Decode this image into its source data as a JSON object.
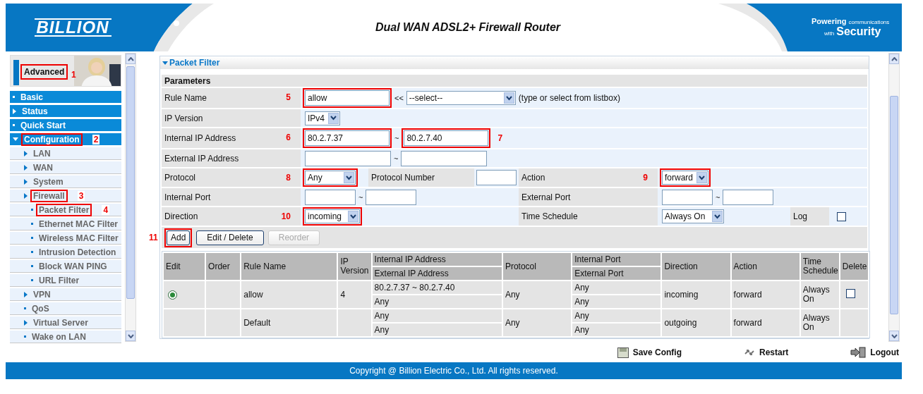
{
  "header": {
    "logo": "BILLION",
    "title": "Dual WAN ADSL2+ Firewall Router",
    "tagline": {
      "lead": "Powering",
      "small_1": "communications",
      "small_2": "with",
      "big": "Security"
    }
  },
  "sidebar": {
    "mode": {
      "label": "Advanced",
      "callout": "1"
    },
    "items": [
      {
        "label": "Basic",
        "kind": "dot"
      },
      {
        "label": "Status",
        "kind": "right"
      },
      {
        "label": "Quick Start",
        "kind": "dot"
      },
      {
        "label": "Configuration",
        "kind": "down",
        "callout": "2",
        "children": [
          {
            "label": "LAN",
            "kind": "right"
          },
          {
            "label": "WAN",
            "kind": "right"
          },
          {
            "label": "System",
            "kind": "right"
          },
          {
            "label": "Firewall",
            "kind": "right",
            "callout": "3",
            "children": [
              {
                "label": "Packet Filter",
                "kind": "dot",
                "callout": "4"
              },
              {
                "label": "Ethernet MAC Filter",
                "kind": "dot"
              },
              {
                "label": "Wireless MAC Filter",
                "kind": "dot"
              },
              {
                "label": "Intrusion Detection",
                "kind": "dot"
              },
              {
                "label": "Block WAN PING",
                "kind": "dot"
              },
              {
                "label": "URL Filter",
                "kind": "dot"
              }
            ]
          },
          {
            "label": "VPN",
            "kind": "right"
          },
          {
            "label": "QoS",
            "kind": "dot"
          },
          {
            "label": "Virtual Server",
            "kind": "right"
          },
          {
            "label": "Wake on LAN",
            "kind": "dot"
          }
        ]
      }
    ]
  },
  "panel": {
    "title": "Packet Filter",
    "parameters_title": "Parameters",
    "rule_name": {
      "label": "Rule Name",
      "callout": "5",
      "value": "allow",
      "separator": "<<",
      "select": "--select--",
      "hint": "(type or select from listbox)"
    },
    "ip_version": {
      "label": "IP Version",
      "select": "IPv4"
    },
    "internal_ip": {
      "label": "Internal IP Address",
      "callout": "6",
      "from": "80.2.7.37",
      "separator": "~",
      "to": "80.2.7.40",
      "to_callout": "7"
    },
    "external_ip": {
      "label": "External IP Address",
      "separator": "~"
    },
    "protocol": {
      "label": "Protocol",
      "callout": "8",
      "select": "Any"
    },
    "protocol_number": {
      "label": "Protocol Number"
    },
    "action": {
      "label": "Action",
      "callout": "9",
      "select": "forward"
    },
    "internal_port": {
      "label": "Internal Port",
      "separator": "~"
    },
    "external_port": {
      "label": "External Port",
      "separator": "~"
    },
    "direction": {
      "label": "Direction",
      "callout": "10",
      "select": "incoming"
    },
    "time_schedule": {
      "label": "Time Schedule",
      "select": "Always On"
    },
    "log": {
      "label": "Log",
      "checked": false
    },
    "buttons": [
      {
        "label": "Add",
        "disabled": false,
        "callout": "11"
      },
      {
        "label": "Edit / Delete",
        "disabled": false
      },
      {
        "label": "Reorder",
        "disabled": true
      }
    ]
  },
  "table": {
    "columns": {
      "edit": "Edit",
      "order": "Order",
      "rule_name": "Rule Name",
      "ip_version": "IP Version",
      "internal_ip": "Internal IP Address",
      "external_ip": "External IP Address",
      "protocol": "Protocol",
      "internal_port": "Internal Port",
      "external_port": "External Port",
      "direction": "Direction",
      "action": "Action",
      "time_schedule": "Time Schedule",
      "delete": "Delete"
    },
    "rows": [
      {
        "radio": {
          "selected": true
        },
        "rule_name": "allow",
        "ip_version": "4",
        "internal_ip": "80.2.7.37 ~ 80.2.7.40",
        "external_ip": "Any",
        "protocol": "Any",
        "internal_port": "Any",
        "external_port": "Any",
        "direction": "incoming",
        "action": "forward",
        "time_schedule": "Always On",
        "delete": {
          "checked": false
        }
      },
      {
        "rule_name": "Default",
        "internal_ip": "Any",
        "external_ip": "Any",
        "protocol": "Any",
        "internal_port": "Any",
        "external_port": "Any",
        "direction": "outgoing",
        "action": "forward",
        "time_schedule": "Always On"
      }
    ]
  },
  "footer": {
    "links": [
      {
        "kind": "save",
        "label": "Save Config"
      },
      {
        "kind": "restart",
        "label": "Restart"
      },
      {
        "kind": "logout",
        "label": "Logout"
      }
    ],
    "copyright": "Copyright @ Billion Electric Co., Ltd. All rights reserved."
  }
}
